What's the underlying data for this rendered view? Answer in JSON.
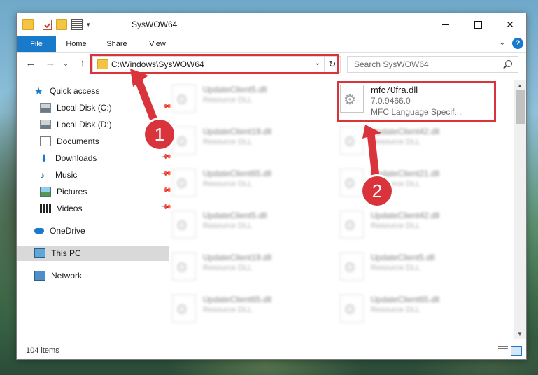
{
  "window": {
    "title": "SysWOW64",
    "minimize_icon": "minimize-icon",
    "maximize_icon": "maximize-icon",
    "close_glyph": "✕"
  },
  "ribbon": {
    "tabs": [
      "File",
      "Home",
      "Share",
      "View"
    ],
    "expand_glyph": "⌄",
    "help_glyph": "?"
  },
  "nav": {
    "back_glyph": "←",
    "forward_glyph": "→",
    "recent_glyph": "⌄",
    "up_glyph": "↑",
    "address": "C:\\Windows\\SysWOW64",
    "address_drop_glyph": "⌄",
    "refresh_glyph": "↻",
    "search_placeholder": "Search SysWOW64"
  },
  "sidebar": {
    "items": [
      {
        "label": "Quick access",
        "icon": "star-icon"
      },
      {
        "label": "Local Disk (C:)",
        "icon": "drive-icon",
        "pinned": true
      },
      {
        "label": "Local Disk (D:)",
        "icon": "drive-icon",
        "pinned": true
      },
      {
        "label": "Documents",
        "icon": "documents-icon",
        "pinned": true
      },
      {
        "label": "Downloads",
        "icon": "downloads-icon",
        "pinned": true
      },
      {
        "label": "Music",
        "icon": "music-icon",
        "pinned": true
      },
      {
        "label": "Pictures",
        "icon": "pictures-icon",
        "pinned": true
      },
      {
        "label": "Videos",
        "icon": "videos-icon",
        "pinned": true
      },
      {
        "label": "OneDrive",
        "icon": "cloud-icon"
      },
      {
        "label": "This PC",
        "icon": "computer-icon",
        "selected": true
      },
      {
        "label": "Network",
        "icon": "network-icon"
      }
    ],
    "pin_glyph": "📌"
  },
  "files": {
    "highlighted": {
      "name": "mfc70fra.dll",
      "version": "7.0.9466.0",
      "description": "MFC Language Specif..."
    },
    "blurred": [
      {
        "name": "UpdateClient5.dll",
        "type": "Resource DLL"
      },
      {
        "name": "UpdateClient19.dll",
        "type": "Resource DLL"
      },
      {
        "name": "UpdateClient42.dll",
        "type": "Resource DLL"
      },
      {
        "name": "UpdateClient65.dll",
        "type": "Resource DLL"
      },
      {
        "name": "UpdateClient21.dll",
        "type": "Resource DLL"
      },
      {
        "name": "UpdateClient5.dll",
        "type": "Resource DLL"
      },
      {
        "name": "UpdateClient42.dll",
        "type": "Resource DLL"
      },
      {
        "name": "UpdateClient19.dll",
        "type": "Resource DLL"
      },
      {
        "name": "UpdateClient5.dll",
        "type": "Resource DLL"
      },
      {
        "name": "UpdateClient65.dll",
        "type": "Resource DLL"
      },
      {
        "name": "UpdateClient65.dll",
        "type": "Resource DLL"
      }
    ]
  },
  "status": {
    "item_count": "104 items"
  },
  "scroll": {
    "up_glyph": "▲",
    "down_glyph": "▼"
  },
  "annotations": {
    "step1": "1",
    "step2": "2",
    "accent_color": "#d9343b"
  },
  "colors": {
    "file_tab": "#1979ca",
    "selected_bg": "#d9d9d9"
  }
}
